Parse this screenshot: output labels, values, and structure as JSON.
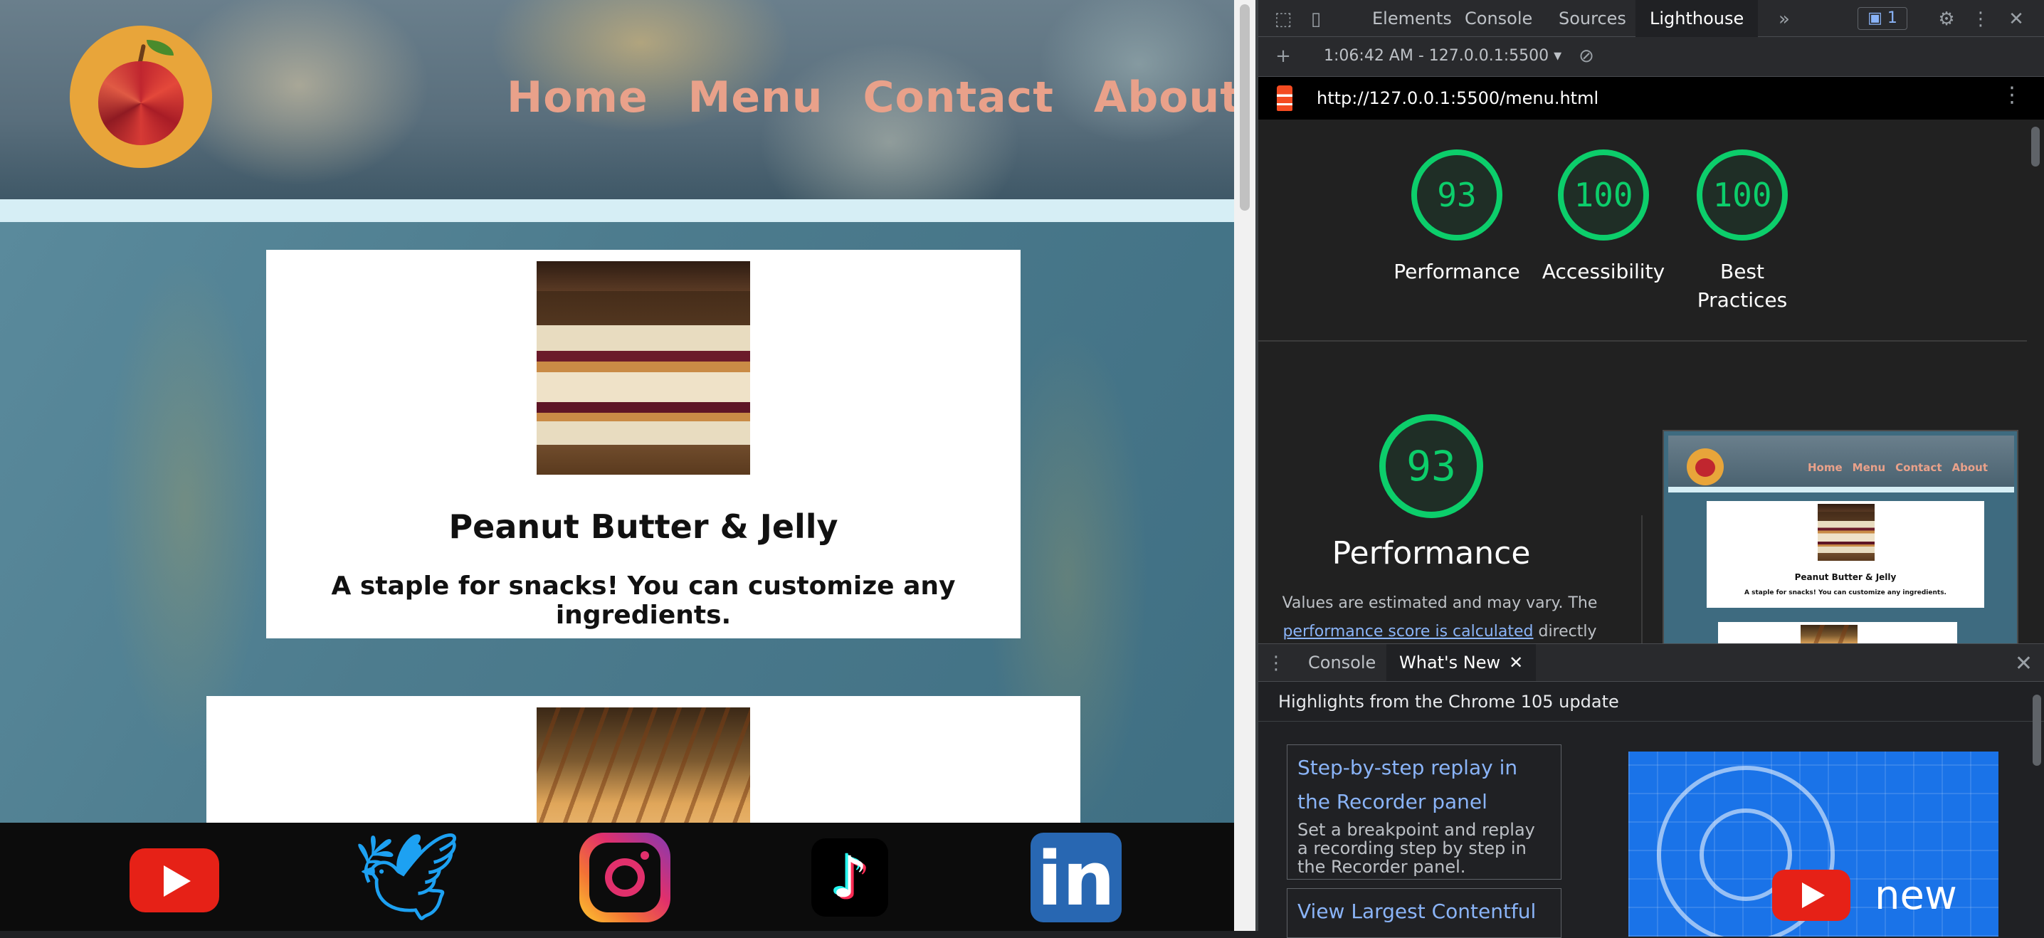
{
  "site": {
    "nav": [
      "Home",
      "Menu",
      "Contact",
      "About"
    ],
    "cards": [
      {
        "title": "Peanut Butter & Jelly",
        "text": "A staple for snacks! You can customize any ingredients."
      }
    ],
    "social": [
      "youtube-icon",
      "twitter-icon",
      "instagram-icon",
      "tiktok-icon",
      "linkedin-icon"
    ],
    "colors": {
      "nav_text": "#e9a18a",
      "strip": "#d6eef5",
      "footer": "#0c0c0c"
    }
  },
  "devtools": {
    "tabs": [
      "Elements",
      "Console",
      "Sources",
      "Lighthouse"
    ],
    "active_tab": "Lighthouse",
    "issues_count": "1",
    "report_select": "1:06:42 AM - 127.0.0.1:5500",
    "url": "http://127.0.0.1:5500/menu.html",
    "scores": [
      {
        "value": "93",
        "label": "Performance"
      },
      {
        "value": "100",
        "label": "Accessibility"
      },
      {
        "value": "100",
        "label": "Best Practices"
      }
    ],
    "performance": {
      "score": "93",
      "title": "Performance",
      "desc_before": "Values are estimated and may vary. The ",
      "desc_link": "performance score is calculated",
      "desc_after": " directly from"
    },
    "thumbnail": {
      "nav": [
        "Home",
        "Menu",
        "Contact",
        "About"
      ],
      "title": "Peanut Butter & Jelly",
      "text": "A staple for snacks! You can customize any ingredients."
    },
    "drawer": {
      "tabs": [
        "Console",
        "What's New"
      ],
      "active_tab": "What's New",
      "heading": "Highlights from the Chrome 105 update",
      "items": [
        {
          "title": "Step-by-step replay in the Recorder panel",
          "desc": "Set a breakpoint and replay a recording step by step in the Recorder panel."
        },
        {
          "title": "View Largest Contentful",
          "desc": ""
        }
      ],
      "video_text": "new"
    },
    "colors": {
      "score_good": "#0cce6b",
      "link": "#8ab4f8",
      "panel_bg": "#202124"
    }
  }
}
